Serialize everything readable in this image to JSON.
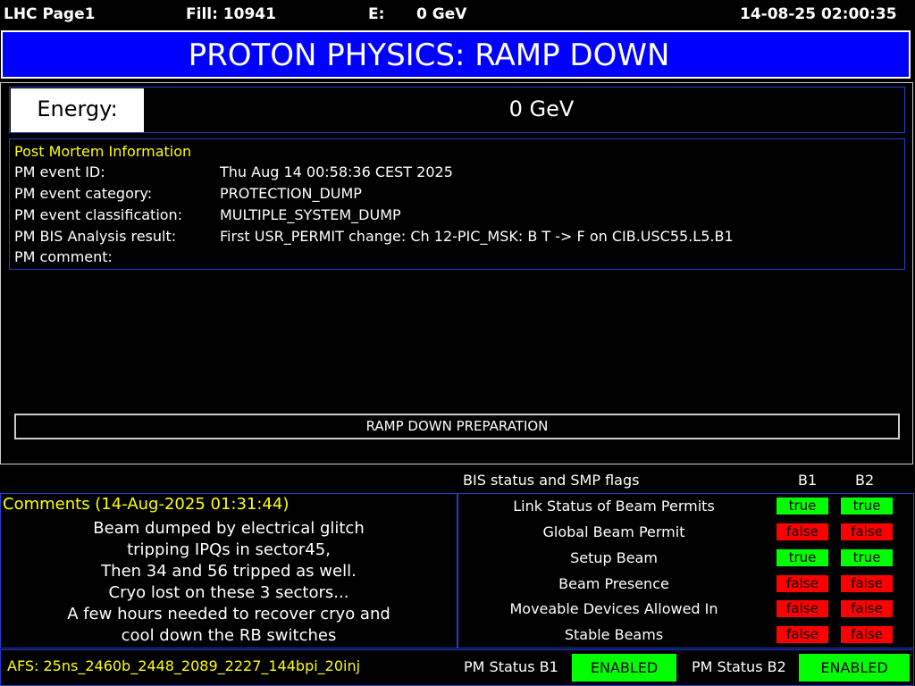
{
  "header": {
    "page": "LHC Page1",
    "fill": "Fill: 10941",
    "energy_label": "E:",
    "energy_value": "0 GeV",
    "datetime": "14-08-25 02:00:35"
  },
  "title": "PROTON PHYSICS: RAMP DOWN",
  "energy": {
    "label": "Energy:",
    "value": "0 GeV"
  },
  "post_mortem": {
    "title": "Post Mortem Information",
    "rows": [
      {
        "label": "PM event ID:",
        "value": "Thu Aug 14 00:58:36 CEST 2025"
      },
      {
        "label": "PM event category:",
        "value": "PROTECTION_DUMP"
      },
      {
        "label": "PM event classification:",
        "value": "MULTIPLE_SYSTEM_DUMP"
      },
      {
        "label": "PM BIS Analysis result:",
        "value": "First USR_PERMIT change: Ch 12-PIC_MSK: B T -> F on CIB.USC55.L5.B1"
      },
      {
        "label": "PM comment:",
        "value": ""
      }
    ]
  },
  "status_banner": "RAMP DOWN PREPARATION",
  "bis": {
    "title": "BIS status and SMP flags",
    "col_b1": "B1",
    "col_b2": "B2",
    "flags": [
      {
        "label": "Link Status of Beam Permits",
        "b1": "true",
        "b2": "true"
      },
      {
        "label": "Global Beam Permit",
        "b1": "false",
        "b2": "false"
      },
      {
        "label": "Setup Beam",
        "b1": "true",
        "b2": "true"
      },
      {
        "label": "Beam Presence",
        "b1": "false",
        "b2": "false"
      },
      {
        "label": "Moveable Devices Allowed In",
        "b1": "false",
        "b2": "false"
      },
      {
        "label": "Stable Beams",
        "b1": "false",
        "b2": "false"
      }
    ]
  },
  "comments": {
    "title": "Comments (14-Aug-2025 01:31:44)",
    "lines": [
      "Beam dumped by electrical glitch",
      "tripping IPQs in sector45,",
      "Then 34 and 56 tripped as well.",
      "Cryo lost on these 3 sectors...",
      "A few hours needed to recover cryo and",
      "cool down the RB switches"
    ]
  },
  "footer": {
    "afs": "AFS: 25ns_2460b_2448_2089_2227_144bpi_20inj",
    "pm_status_b1_label": "PM Status B1",
    "pm_status_b1_value": "ENABLED",
    "pm_status_b2_label": "PM Status B2",
    "pm_status_b2_value": "ENABLED"
  },
  "colors": {
    "title_bg": "#0000ff",
    "true": "#00ff00",
    "false": "#ff0000",
    "highlight_text": "#ffff00"
  }
}
